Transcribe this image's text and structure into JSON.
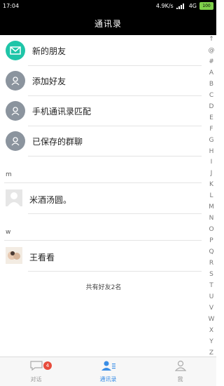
{
  "status_bar": {
    "time": "17:04",
    "network": "4.9K/s",
    "signal": "4G",
    "battery": "100"
  },
  "title": "通讯录",
  "menu": [
    {
      "label": "新的朋友",
      "icon": "mail-icon",
      "color": "#1fc5a8"
    },
    {
      "label": "添加好友",
      "icon": "person-icon",
      "color": "#8b949e"
    },
    {
      "label": "手机通讯录匹配",
      "icon": "person-icon",
      "color": "#8b949e"
    },
    {
      "label": "已保存的群聊",
      "icon": "person-icon",
      "color": "#8b949e"
    }
  ],
  "sections": [
    {
      "letter": "m",
      "contacts": [
        {
          "name": "米酒汤圆。",
          "avatar": "default-avatar"
        }
      ]
    },
    {
      "letter": "w",
      "contacts": [
        {
          "name": "王看看",
          "avatar": "photo-avatar"
        }
      ]
    }
  ],
  "footer": "共有好友2名",
  "index": [
    "↑",
    "@",
    "#",
    "A",
    "B",
    "C",
    "D",
    "E",
    "F",
    "G",
    "H",
    "I",
    "J",
    "K",
    "L",
    "M",
    "N",
    "O",
    "P",
    "Q",
    "R",
    "S",
    "T",
    "U",
    "V",
    "W",
    "X",
    "Y",
    "Z"
  ],
  "bottom_nav": [
    {
      "label": "对话",
      "badge": "4",
      "active": false
    },
    {
      "label": "通讯录",
      "active": true
    },
    {
      "label": "我",
      "active": false
    }
  ],
  "colors": {
    "accent": "#3a8ee6",
    "teal": "#1fc5a8",
    "badge": "#e74c3c"
  }
}
